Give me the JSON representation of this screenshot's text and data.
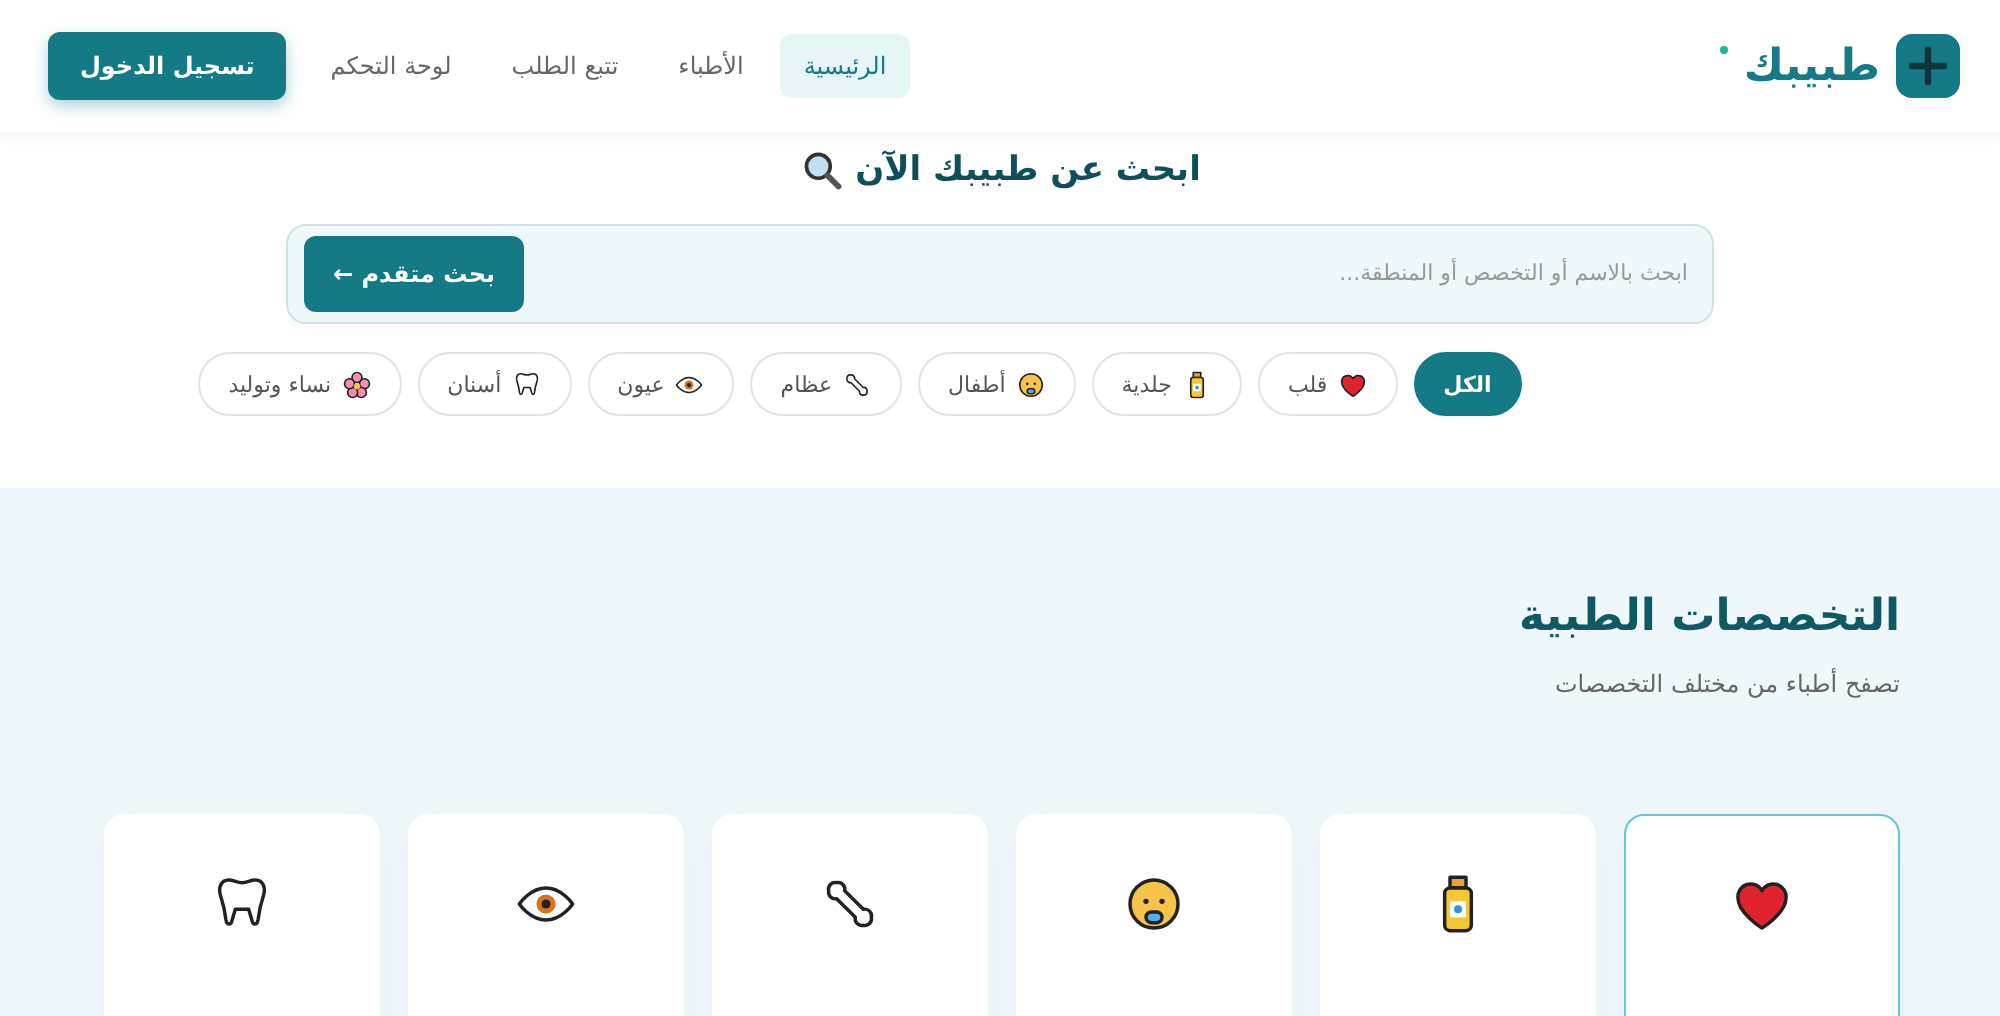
{
  "header": {
    "logo": "طبيبك",
    "nav": [
      {
        "label": "الرئيسية",
        "selected": true
      },
      {
        "label": "الأطباء",
        "selected": false
      },
      {
        "label": "تتبع الطلب",
        "selected": false
      },
      {
        "label": "لوحة التحكم",
        "selected": false
      }
    ],
    "login": "تسجيل الدخول"
  },
  "search": {
    "title": "ابحث عن طبيبك الآن",
    "placeholder": "ابحث بالاسم أو التخصص أو المنطقة...",
    "button": "بحث متقدم ←",
    "chips": [
      {
        "label": "الكل",
        "selected": true
      },
      {
        "label": "قلب",
        "selected": false
      },
      {
        "label": "جلدية",
        "selected": false
      },
      {
        "label": "أطفال",
        "selected": false
      },
      {
        "label": "عظام",
        "selected": false
      },
      {
        "label": "عيون",
        "selected": false
      },
      {
        "label": "أسنان",
        "selected": false
      },
      {
        "label": "نساء وتوليد",
        "selected": false
      }
    ]
  },
  "specialties": {
    "title": "التخصصات الطبية",
    "subtitle": "تصفح أطباء من مختلف التخصصات",
    "cards": [
      {
        "selected": true
      },
      {
        "selected": false
      },
      {
        "selected": false
      },
      {
        "selected": false
      },
      {
        "selected": false
      },
      {
        "selected": false
      }
    ]
  }
}
